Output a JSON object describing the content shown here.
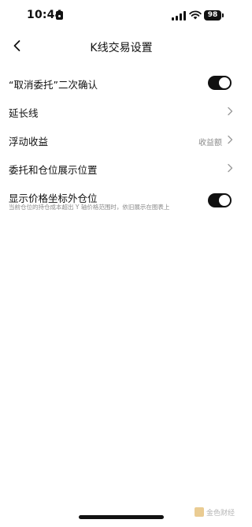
{
  "status_bar": {
    "time": "10:44",
    "battery": "98"
  },
  "nav": {
    "title": "K线交易设置"
  },
  "settings": [
    {
      "label": "“取消委托”二次确认",
      "type": "toggle",
      "on": true
    },
    {
      "label": "延长线",
      "type": "link"
    },
    {
      "label": "浮动收益",
      "type": "select",
      "value": "收益额"
    },
    {
      "label": "委托和仓位展示位置",
      "type": "link"
    },
    {
      "label": "显示价格坐标外仓位",
      "type": "toggle",
      "on": true,
      "description": "当前仓位的持仓成本超出 Y 轴价格范围时，依旧展示在图表上"
    }
  ],
  "watermark": {
    "text": "金色财经"
  }
}
